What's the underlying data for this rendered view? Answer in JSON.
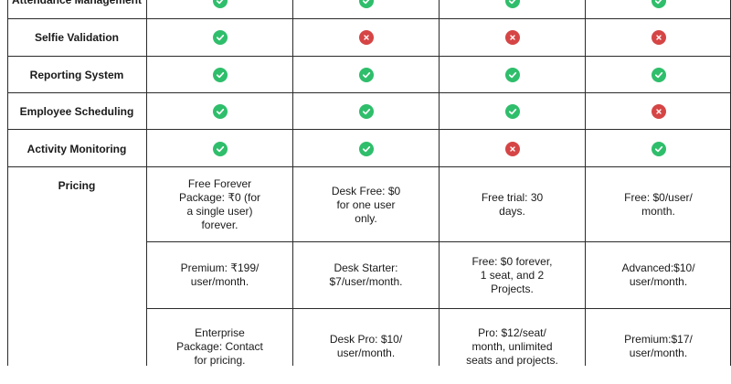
{
  "colors": {
    "check": "#2fbe6b",
    "cross": "#d64545",
    "border": "#2b2b2b"
  },
  "features": [
    {
      "label": "Attendance Management",
      "values": [
        "check",
        "check",
        "check",
        "check"
      ]
    },
    {
      "label": "Selfie Validation",
      "values": [
        "check",
        "cross",
        "cross",
        "cross"
      ]
    },
    {
      "label": "Reporting System",
      "values": [
        "check",
        "check",
        "check",
        "check"
      ]
    },
    {
      "label": "Employee Scheduling",
      "values": [
        "check",
        "check",
        "check",
        "cross"
      ]
    },
    {
      "label": "Activity Monitoring",
      "values": [
        "check",
        "check",
        "cross",
        "check"
      ]
    }
  ],
  "pricing": {
    "label": "Pricing",
    "rows": [
      [
        "Free Forever\nPackage: ₹0 (for\na single user)\nforever.",
        "Desk Free: $0\nfor one user\nonly.",
        "Free trial: 30\ndays.",
        "Free: $0/user/\nmonth."
      ],
      [
        "Premium: ₹199/\nuser/month.",
        "Desk Starter:\n$7/user/month.",
        "Free: $0 forever,\n1 seat, and 2\nProjects.",
        "Advanced:$10/\nuser/month."
      ],
      [
        "Enterprise\nPackage: Contact\nfor pricing.",
        "Desk Pro: $10/\nuser/month.",
        "Pro: $12/seat/\nmonth, unlimited\nseats and projects.",
        "Premium:$17/\nuser/month."
      ]
    ]
  }
}
